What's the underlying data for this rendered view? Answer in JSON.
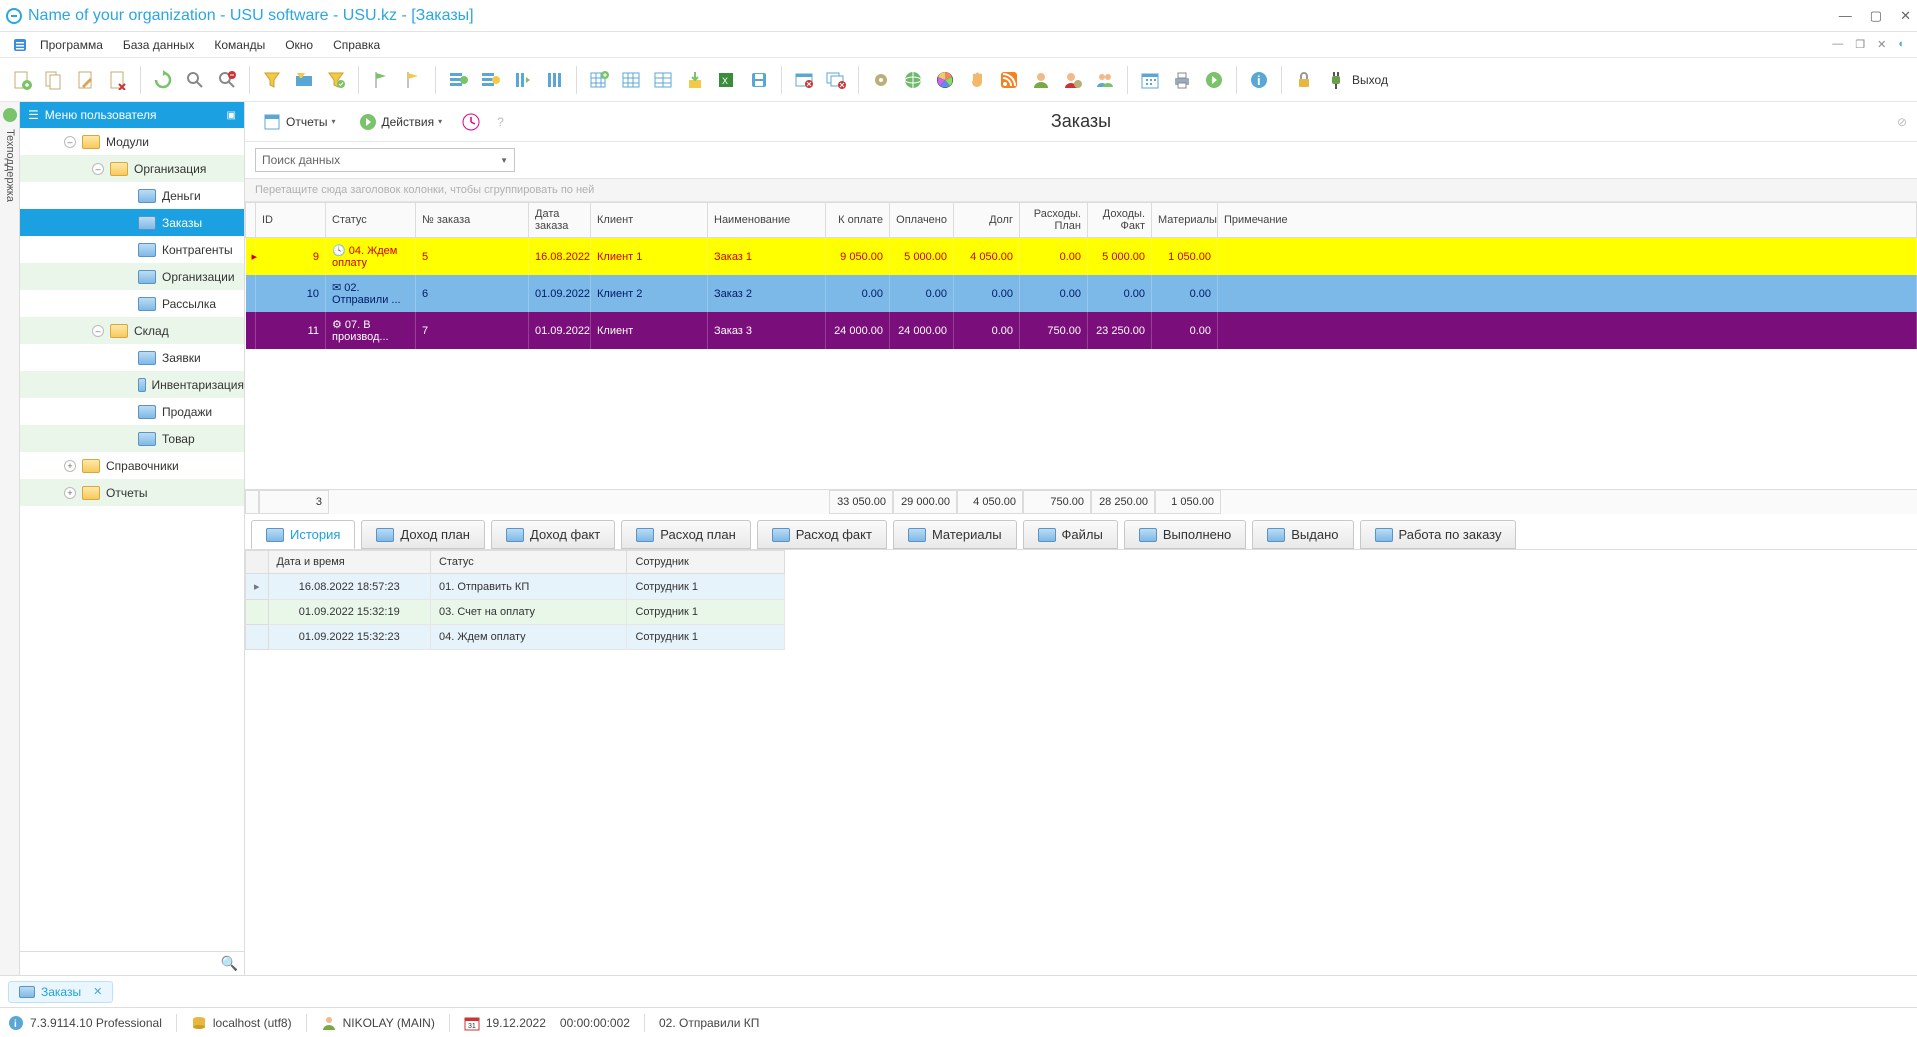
{
  "app": {
    "title": "Name of your organization - USU software - USU.kz - [Заказы]"
  },
  "menubar": {
    "items": [
      "Программа",
      "База данных",
      "Команды",
      "Окно",
      "Справка"
    ]
  },
  "toolbar": {
    "exit_label": "Выход"
  },
  "sidestrip": {
    "label": "Техподдержка"
  },
  "sidebar": {
    "title": "Меню пользователя",
    "tree": {
      "modules": "Модули",
      "organization": "Организация",
      "org_children": [
        "Деньги",
        "Заказы",
        "Контрагенты",
        "Организации",
        "Рассылка"
      ],
      "warehouse": "Склад",
      "wh_children": [
        "Заявки",
        "Инвентаризация",
        "Продажи",
        "Товар"
      ],
      "directories": "Справочники",
      "reports": "Отчеты"
    }
  },
  "subtoolbar": {
    "reports": "Отчеты",
    "actions": "Действия"
  },
  "page_title": "Заказы",
  "search": {
    "placeholder": "Поиск данных"
  },
  "grid": {
    "group_hint": "Перетащите сюда заголовок колонки, чтобы сгруппировать по ней",
    "columns": [
      "ID",
      "Статус",
      "№ заказа",
      "Дата заказа",
      "Клиент",
      "Наименование",
      "К оплате",
      "Оплачено",
      "Долг",
      "Расходы. План",
      "Доходы. Факт",
      "Материалы",
      "Примечание"
    ],
    "rows": [
      {
        "id": "9",
        "status": "04. Ждем оплату",
        "num": "5",
        "date": "16.08.2022",
        "client": "Клиент 1",
        "name": "Заказ 1",
        "pay": "9 050.00",
        "paid": "5 000.00",
        "debt": "4 050.00",
        "exp_plan": "0.00",
        "inc_fact": "5 000.00",
        "materials": "1 050.00",
        "note": "",
        "style": "r-yellow"
      },
      {
        "id": "10",
        "status": "02. Отправили ...",
        "num": "6",
        "date": "01.09.2022",
        "client": "Клиент 2",
        "name": "Заказ 2",
        "pay": "0.00",
        "paid": "0.00",
        "debt": "0.00",
        "exp_plan": "0.00",
        "inc_fact": "0.00",
        "materials": "0.00",
        "note": "",
        "style": "r-blue"
      },
      {
        "id": "11",
        "status": "07. В производ...",
        "num": "7",
        "date": "01.09.2022",
        "client": "Клиент",
        "name": "Заказ 3",
        "pay": "24 000.00",
        "paid": "24 000.00",
        "debt": "0.00",
        "exp_plan": "750.00",
        "inc_fact": "23 250.00",
        "materials": "0.00",
        "note": "",
        "style": "r-purple"
      }
    ],
    "totals": {
      "count": "3",
      "pay": "33 050.00",
      "paid": "29 000.00",
      "debt": "4 050.00",
      "exp_plan": "750.00",
      "inc_fact": "28 250.00",
      "materials": "1 050.00"
    }
  },
  "tabs": [
    "История",
    "Доход план",
    "Доход факт",
    "Расход план",
    "Расход факт",
    "Материалы",
    "Файлы",
    "Выполнено",
    "Выдано",
    "Работа по заказу"
  ],
  "detail": {
    "columns": [
      "Дата и время",
      "Статус",
      "Сотрудник"
    ],
    "rows": [
      {
        "dt": "16.08.2022 18:57:23",
        "status": "01. Отправить КП",
        "emp": "Сотрудник 1",
        "cls": "alt-b"
      },
      {
        "dt": "01.09.2022 15:32:19",
        "status": "03. Счет на оплату",
        "emp": "Сотрудник 1",
        "cls": "alt-g"
      },
      {
        "dt": "01.09.2022 15:32:23",
        "status": "04. Ждем оплату",
        "emp": "Сотрудник 1",
        "cls": "alt-b"
      }
    ]
  },
  "taskbar": {
    "tab": "Заказы"
  },
  "statusbar": {
    "version": "7.3.9114.10 Professional",
    "host": "localhost (utf8)",
    "user": "NIKOLAY (MAIN)",
    "date": "19.12.2022",
    "time": "00:00:00:002",
    "status": "02. Отправили КП"
  }
}
